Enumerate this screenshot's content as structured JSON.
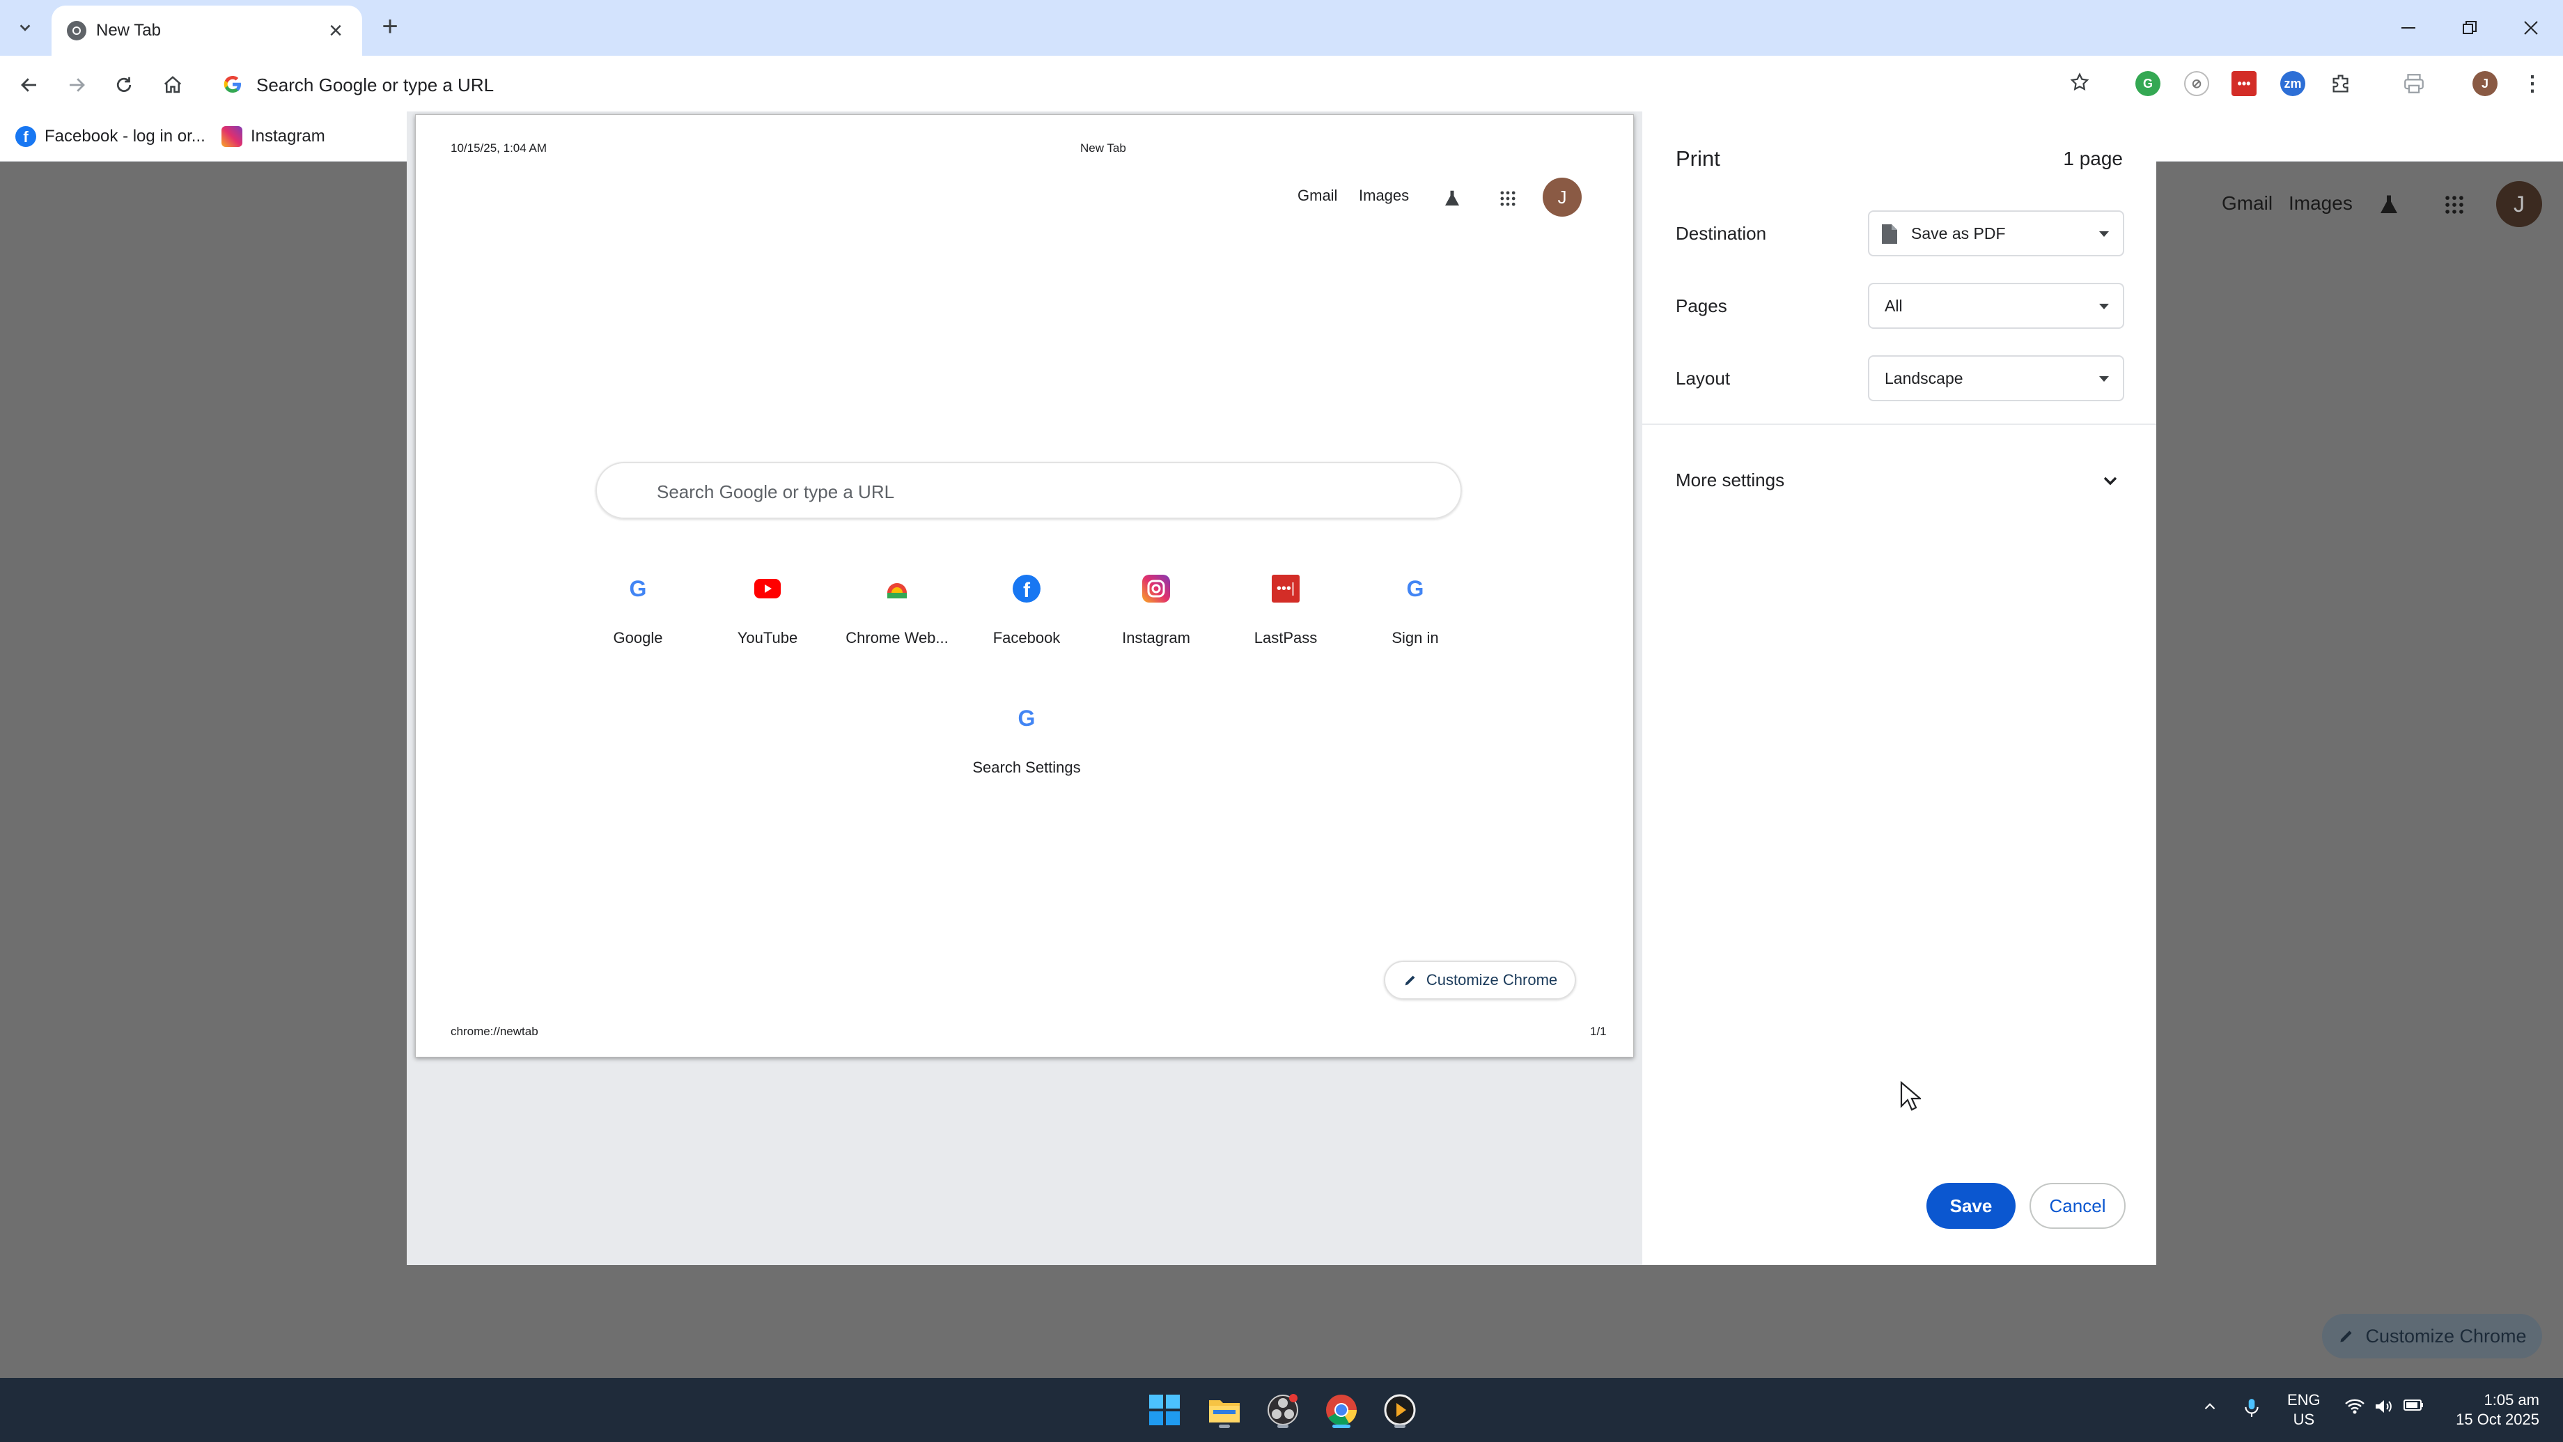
{
  "tab": {
    "title": "New Tab"
  },
  "omnibox": {
    "placeholder": "Search Google or type a URL"
  },
  "bookmarks": [
    {
      "label": "Facebook - log in or..."
    },
    {
      "label": "Instagram"
    }
  ],
  "background_page": {
    "links": [
      "Gmail",
      "Images"
    ],
    "avatar_letter": "J",
    "customize_label": "Customize Chrome"
  },
  "print_preview": {
    "header_datetime": "10/15/25, 1:04 AM",
    "header_title": "New Tab",
    "footer_url": "chrome://newtab",
    "footer_page": "1/1",
    "links": [
      "Gmail",
      "Images"
    ],
    "avatar_letter": "J",
    "search_placeholder": "Search Google or type a URL",
    "shortcuts": [
      {
        "label": "Google",
        "icon": "google-icon"
      },
      {
        "label": "YouTube",
        "icon": "youtube-icon"
      },
      {
        "label": "Chrome Web...",
        "icon": "chrome-web-store-icon"
      },
      {
        "label": "Facebook",
        "icon": "facebook-icon"
      },
      {
        "label": "Instagram",
        "icon": "instagram-icon"
      },
      {
        "label": "LastPass",
        "icon": "lastpass-icon"
      },
      {
        "label": "Sign in",
        "icon": "google-icon"
      },
      {
        "label": "Search Settings",
        "icon": "google-icon"
      }
    ],
    "customize_label": "Customize Chrome"
  },
  "print_settings": {
    "title": "Print",
    "page_count": "1 page",
    "destination": {
      "label": "Destination",
      "value": "Save as PDF"
    },
    "pages": {
      "label": "Pages",
      "value": "All"
    },
    "layout": {
      "label": "Layout",
      "value": "Landscape"
    },
    "more_settings": "More settings",
    "save": "Save",
    "cancel": "Cancel"
  },
  "taskbar": {
    "language": "ENG",
    "region": "US",
    "time": "1:05 am",
    "date": "15 Oct 2025"
  },
  "colors": {
    "accent": "#0b57d0",
    "tabstrip": "#d3e3fd",
    "overlay": "#6f6f6f",
    "taskbar": "#1f2b3a"
  }
}
